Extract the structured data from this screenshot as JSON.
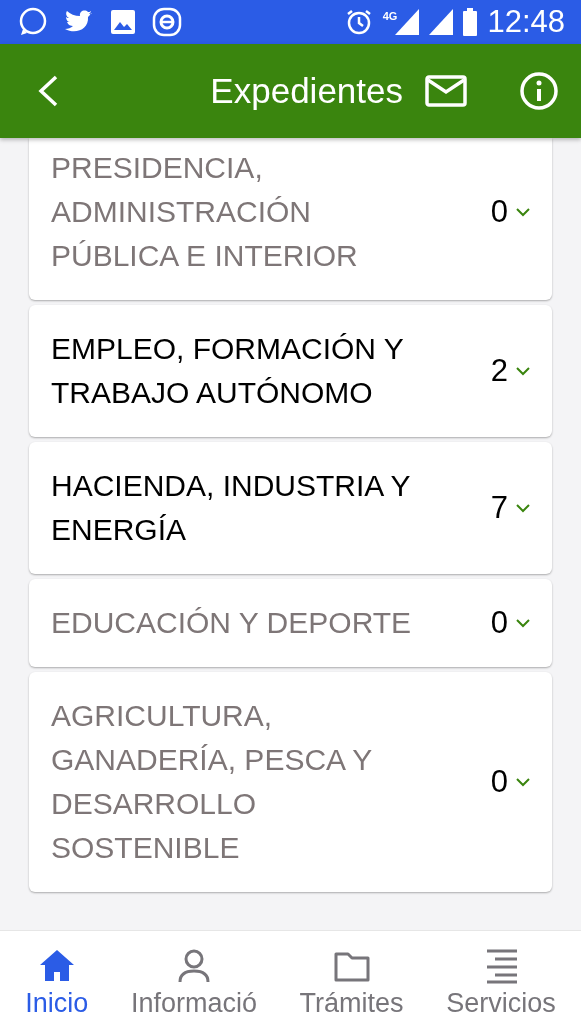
{
  "status_bar": {
    "time": "12:48",
    "network": "4G"
  },
  "header": {
    "title": "Expedientes"
  },
  "cards": [
    {
      "title": "PRESIDENCIA, ADMINISTRACIÓN PÚBLICA E INTERIOR",
      "count": "0",
      "disabled": true
    },
    {
      "title": "EMPLEO, FORMACIÓN Y TRABAJO AUTÓNOMO",
      "count": "2",
      "disabled": false
    },
    {
      "title": "HACIENDA, INDUSTRIA Y ENERGÍA",
      "count": "7",
      "disabled": false
    },
    {
      "title": "EDUCACIÓN Y DEPORTE",
      "count": "0",
      "disabled": true
    },
    {
      "title": "AGRICULTURA, GANADERÍA, PESCA Y DESARROLLO SOSTENIBLE",
      "count": "0",
      "disabled": true
    }
  ],
  "tabs": [
    {
      "label": "Inicio",
      "kind": "home",
      "selected": true
    },
    {
      "label": "Informació",
      "kind": "person",
      "selected": false
    },
    {
      "label": "Trámites",
      "kind": "folder",
      "selected": false
    },
    {
      "label": "Servicios",
      "kind": "list",
      "selected": false
    }
  ]
}
